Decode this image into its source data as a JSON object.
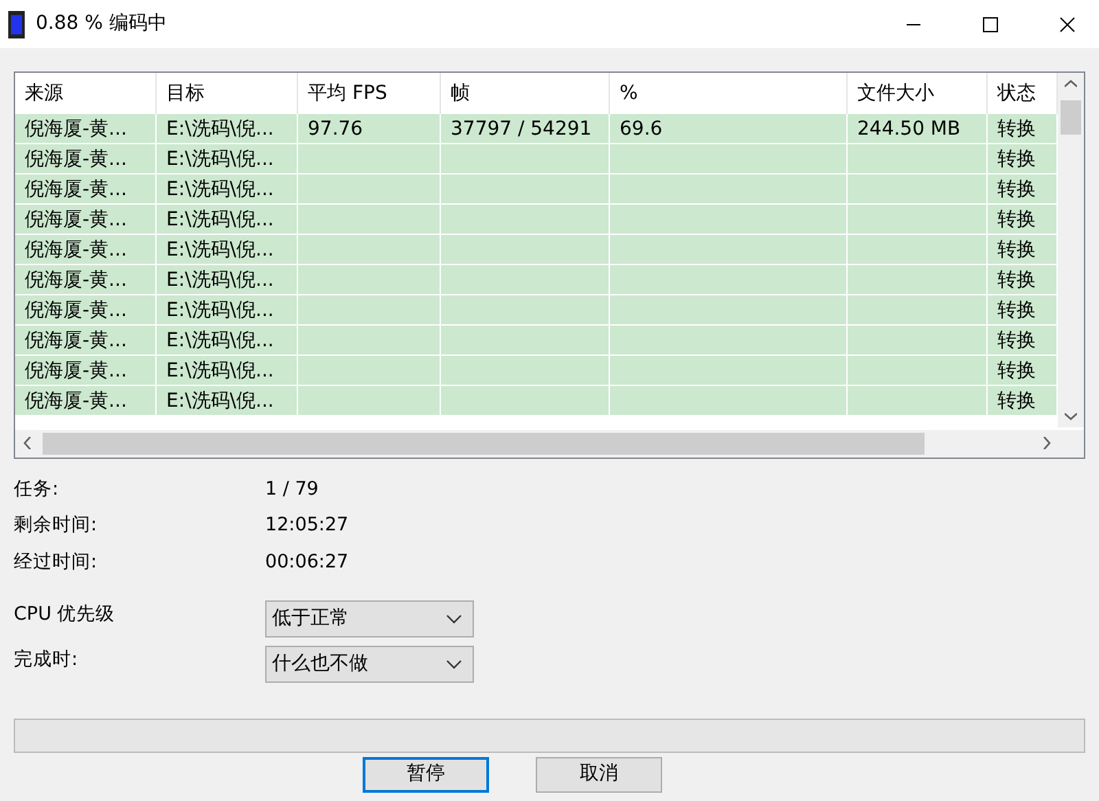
{
  "window": {
    "title": "0.88 % 编码中"
  },
  "table": {
    "columns": [
      "来源",
      "目标",
      "平均 FPS",
      "帧",
      "%",
      "文件大小",
      "状态"
    ],
    "rows": [
      {
        "source": "倪海厦-黄...",
        "target": "E:\\洗码\\倪...",
        "fps": "97.76",
        "frames": "37797 / 54291",
        "percent": "69.6",
        "size": "244.50 MB",
        "status": "转换"
      },
      {
        "source": "倪海厦-黄...",
        "target": "E:\\洗码\\倪...",
        "status": "转换"
      },
      {
        "source": "倪海厦-黄...",
        "target": "E:\\洗码\\倪...",
        "status": "转换"
      },
      {
        "source": "倪海厦-黄...",
        "target": "E:\\洗码\\倪...",
        "status": "转换"
      },
      {
        "source": "倪海厦-黄...",
        "target": "E:\\洗码\\倪...",
        "status": "转换"
      },
      {
        "source": "倪海厦-黄...",
        "target": "E:\\洗码\\倪...",
        "status": "转换"
      },
      {
        "source": "倪海厦-黄...",
        "target": "E:\\洗码\\倪...",
        "status": "转换"
      },
      {
        "source": "倪海厦-黄...",
        "target": "E:\\洗码\\倪...",
        "status": "转换"
      },
      {
        "source": "倪海厦-黄...",
        "target": "E:\\洗码\\倪...",
        "status": "转换"
      },
      {
        "source": "倪海厦-黄...",
        "target": "E:\\洗码\\倪...",
        "status": "转换"
      }
    ]
  },
  "info": [
    {
      "label": "任务:",
      "value": "1 / 79"
    },
    {
      "label": "剩余时间:",
      "value": "12:05:27"
    },
    {
      "label": "经过时间:",
      "value": "00:06:27"
    }
  ],
  "settings": [
    {
      "label": "CPU 优先级",
      "value": "低于正常"
    },
    {
      "label": "完成时:",
      "value": "什么也不做"
    }
  ],
  "progress": {
    "level": 0
  },
  "buttons": [
    {
      "label": "暂停",
      "focused": true
    },
    {
      "label": "取消",
      "focused": false
    }
  ]
}
